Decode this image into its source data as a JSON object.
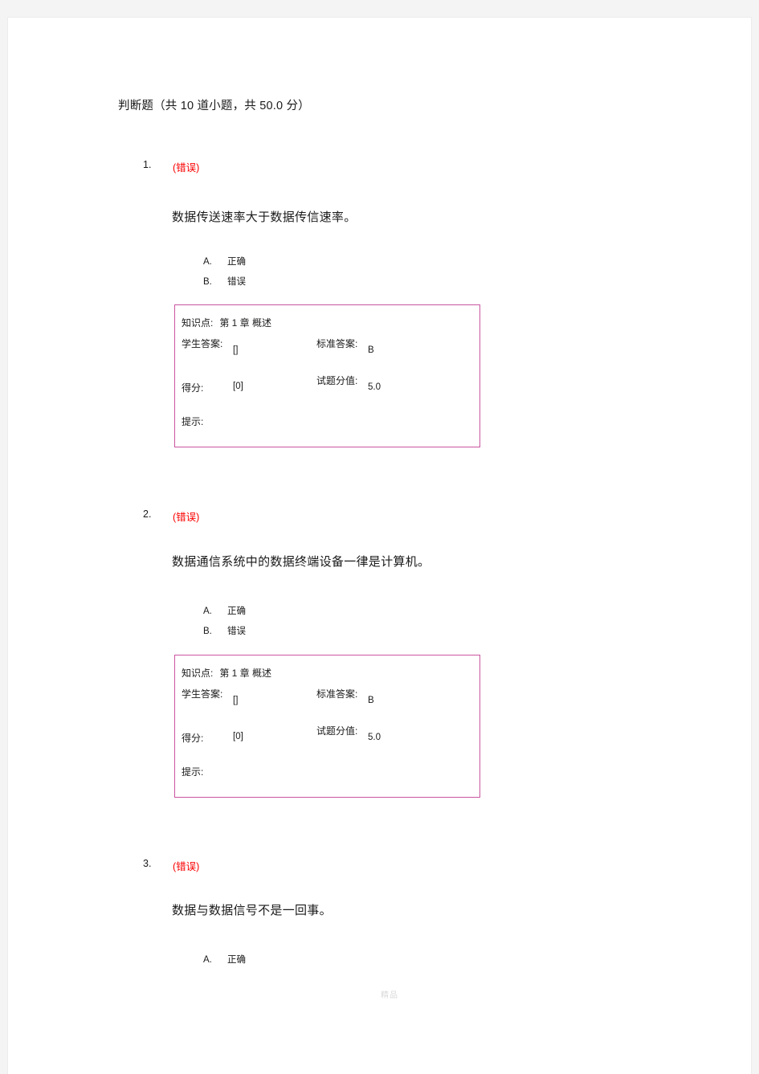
{
  "document": {
    "section_title": "判断题（共 10 道小题，共 50.0 分）",
    "watermark": "精品"
  },
  "answer_box_labels": {
    "knowledge_point": "知识点:",
    "student_answer": "学生答案:",
    "standard_answer": "标准答案:",
    "score": "得分:",
    "full_score": "试题分值:",
    "tip": "提示:"
  },
  "questions": [
    {
      "index": "1.",
      "verdict": "(错误)",
      "stem": "数据传送速率大于数据传信速率。",
      "options": [
        {
          "letter": "A.",
          "text": "正确"
        },
        {
          "letter": "B.",
          "text": "错误"
        }
      ],
      "answer_box": {
        "knowledge_point_value": "第 1 章  概述",
        "student_answer_value": "[]",
        "standard_answer_value": "B",
        "score_value": "[0]",
        "full_score_value": "5.0",
        "tip_value": ""
      }
    },
    {
      "index": "2.",
      "verdict": "(错误)",
      "stem": "数据通信系统中的数据终端设备一律是计算机。",
      "options": [
        {
          "letter": "A.",
          "text": "正确"
        },
        {
          "letter": "B.",
          "text": "错误"
        }
      ],
      "answer_box": {
        "knowledge_point_value": "第 1 章  概述",
        "student_answer_value": "[]",
        "standard_answer_value": "B",
        "score_value": "[0]",
        "full_score_value": "5.0",
        "tip_value": ""
      }
    },
    {
      "index": "3.",
      "verdict": "(错误)",
      "stem": "数据与数据信号不是一回事。",
      "options": [
        {
          "letter": "A.",
          "text": "正确"
        }
      ]
    }
  ],
  "colors": {
    "verdict_red": "#fa0000",
    "box_border_pink": "#c9559f",
    "page_background": "#ffffff",
    "canvas_background": "#f4f4f4"
  }
}
